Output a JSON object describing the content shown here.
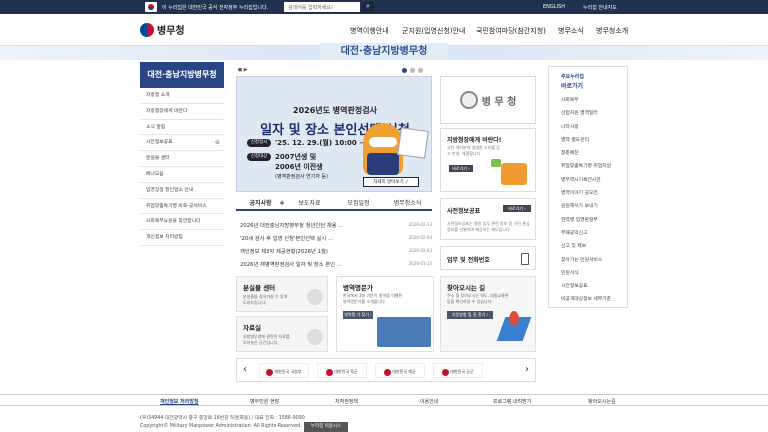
{
  "gov_bar": {
    "text": "이 누리집은 대한민국 공식 전자정부 누리집입니다.",
    "search_placeholder": "검색어를 입력하세요!",
    "english": "ENGLISH",
    "sitemap": "누리집 안내지도"
  },
  "header": {
    "logo": "병무청",
    "gnb": [
      "병역이행안내",
      "군지원(입영신청)안내",
      "국민참여마당(참간지청)",
      "병무소식",
      "병무청소개"
    ]
  },
  "banner": {
    "title": "대전·충남지방병무청"
  },
  "lnb": {
    "title": "대전·충남지방병무청",
    "items": [
      "지방청 소개",
      "지방청장에게 바란다",
      "소식 알림",
      "사전정보공표",
      "분실물 센터",
      "배너모음",
      "입영장정 할인업소 안내",
      "취업맞춤특기병 바로-공서비스",
      "사회복무요원을 찾깐합니다",
      "개인정보 처리방침"
    ],
    "plus": "⊕"
  },
  "slider": {
    "line1": "2026년도 병역판정검사",
    "line2": "일자 및 장소 본인선택 신청",
    "pill1": "신청일시",
    "date": "'25. 12. 29.(월) 10:00 ~",
    "pill2": "신청대상",
    "target1": "2007년생 및",
    "target2": "2006년 이전생",
    "target3": "(병역판정검사 연기자 등)",
    "detail": "자세히 알아보기 ✓",
    "ctrl_prev": "◼ ▶",
    "ctrl_dots": 3
  },
  "side_logo": {
    "text": "병 무 청"
  },
  "wish_box": {
    "title": "지방청장에게 바란다!",
    "desc": "국민 여러분의 생생한 소리를 듣고 반영, 해결합니다.",
    "btn": "바로가기 ›"
  },
  "disclosure": {
    "title": "사전정보공표",
    "btn": "바로가기 ›",
    "desc": "사전정보공표는 행정 업무 관련 정보 중 국민 관심정보를 선별하여 제공하는 제도입니다."
  },
  "tabs": {
    "items": [
      "공지사항",
      "보도자료",
      "모집일정",
      "병무청소식"
    ],
    "plus": "+"
  },
  "notices": [
    {
      "title": "2026년 대전충남지방병무청 청년인턴 채용 ...",
      "date": "2026-02-13"
    },
    {
      "title": "'20세 검사 후 입영 신청'본인선택 실시 ...",
      "date": "2026-02-04"
    },
    {
      "title": "개인정보 제3자 제공현황(2026년 1월)",
      "date": "2026-02-03"
    },
    {
      "title": "2026년 재병역판정검사 일자 및 장소 본인 ...",
      "date": "2026-01-22"
    }
  ],
  "work_box": {
    "title": "업무 및 전화번호"
  },
  "lost": {
    "title": "분실물 센터",
    "desc1": "분실물을 찾아가실 수 있게",
    "desc2": "도와드립니다."
  },
  "data_room": {
    "title": "자료실",
    "desc1": "지방병무청에 관련된 자료를",
    "desc2": "모아놓은 공간입니다."
  },
  "fame": {
    "title": "병역명문가",
    "desc1": "한국에서 3대 가문이 병역을 이행한",
    "desc2": "병역명문가를 소개합니다.",
    "btn": "병역명 가 찾기 ›"
  },
  "location": {
    "title": "찾아오시는 길",
    "desc1": "주소 및 찾아오시는 약도, 대중교통편",
    "desc2": "등을 확인하실 수 있습니다.",
    "btn": "자동방향 밒 길 찾기 ›"
  },
  "orgs": [
    "대한민국 국방부",
    "대한민국 육군",
    "대한민국 해군",
    "대한민국 공군"
  ],
  "quick": {
    "h1": "주요누리집",
    "h2": "바로가기",
    "items": [
      "사회복무",
      "산업지원 병역일터",
      "나라사랑",
      "병역 별도관리",
      "청춘예찬",
      "취업맞춤특기병 취업지원",
      "병무역사기록전시관",
      "병역이야기 공모전",
      "원원해서가 보내기",
      "현역병 입영판정부",
      "부패공익신고",
      "신고 및 제보",
      "찾아가는 민원서비스",
      "민원서식",
      "사전정보공표",
      "비공개대상정보 세부기준"
    ]
  },
  "footer": {
    "nav": [
      "개인정보 처리방침",
      "병무민원 현장",
      "저작권정책",
      "이용안내",
      "프로그램 내려받기",
      "찾아오시는길"
    ],
    "addr": "(우)34944 대전광역시 중구 중앙로 16번길 5(문화동) / 대표 전화 : 1588-9090",
    "copy": "Copyright© Military Manpower Administration. All Rights Reserved.",
    "sys": "누리집 이용시스"
  },
  "colors": {
    "accent": "#2a4585",
    "gov_bar": "#22314f"
  }
}
